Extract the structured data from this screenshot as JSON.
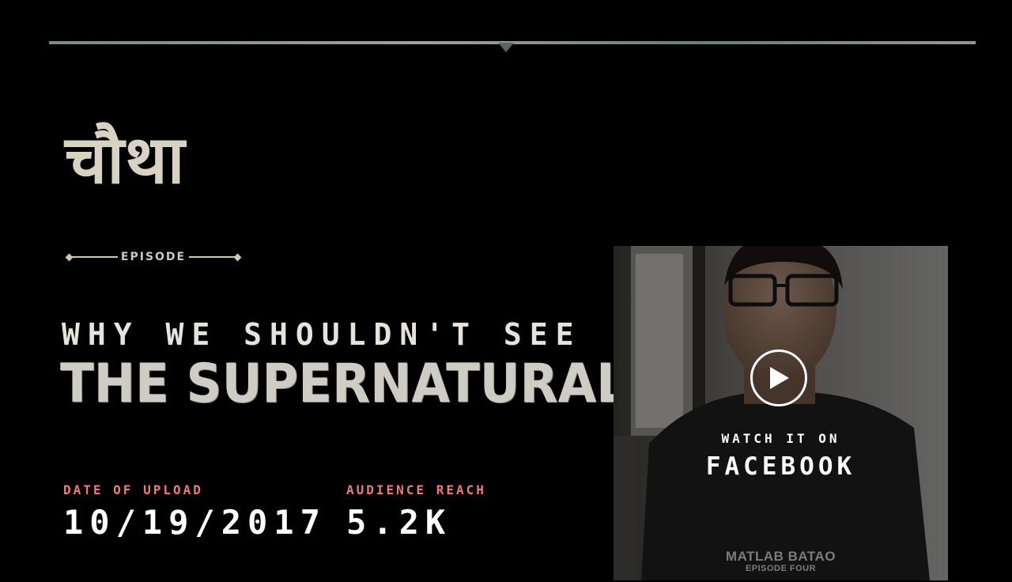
{
  "header": {
    "hindi_title": "चौथा",
    "episode_label": "EPISODE"
  },
  "episode": {
    "subtitle": "WHY WE SHOULDN'T SEE",
    "title": "THE SUPERNATURAL"
  },
  "stats": {
    "date_label": "DATE OF UPLOAD",
    "date_value": "10/19/2017",
    "reach_label": "AUDIENCE REACH",
    "reach_value": "5.2K"
  },
  "video": {
    "watch_small": "WATCH IT ON",
    "watch_platform": "FACEBOOK",
    "caption_title": "MATLAB BATAO",
    "caption_subtitle": "EPISODE FOUR"
  },
  "colors": {
    "background": "#000000",
    "accent_red": "#f07878",
    "beige": "#d8d2c5"
  }
}
